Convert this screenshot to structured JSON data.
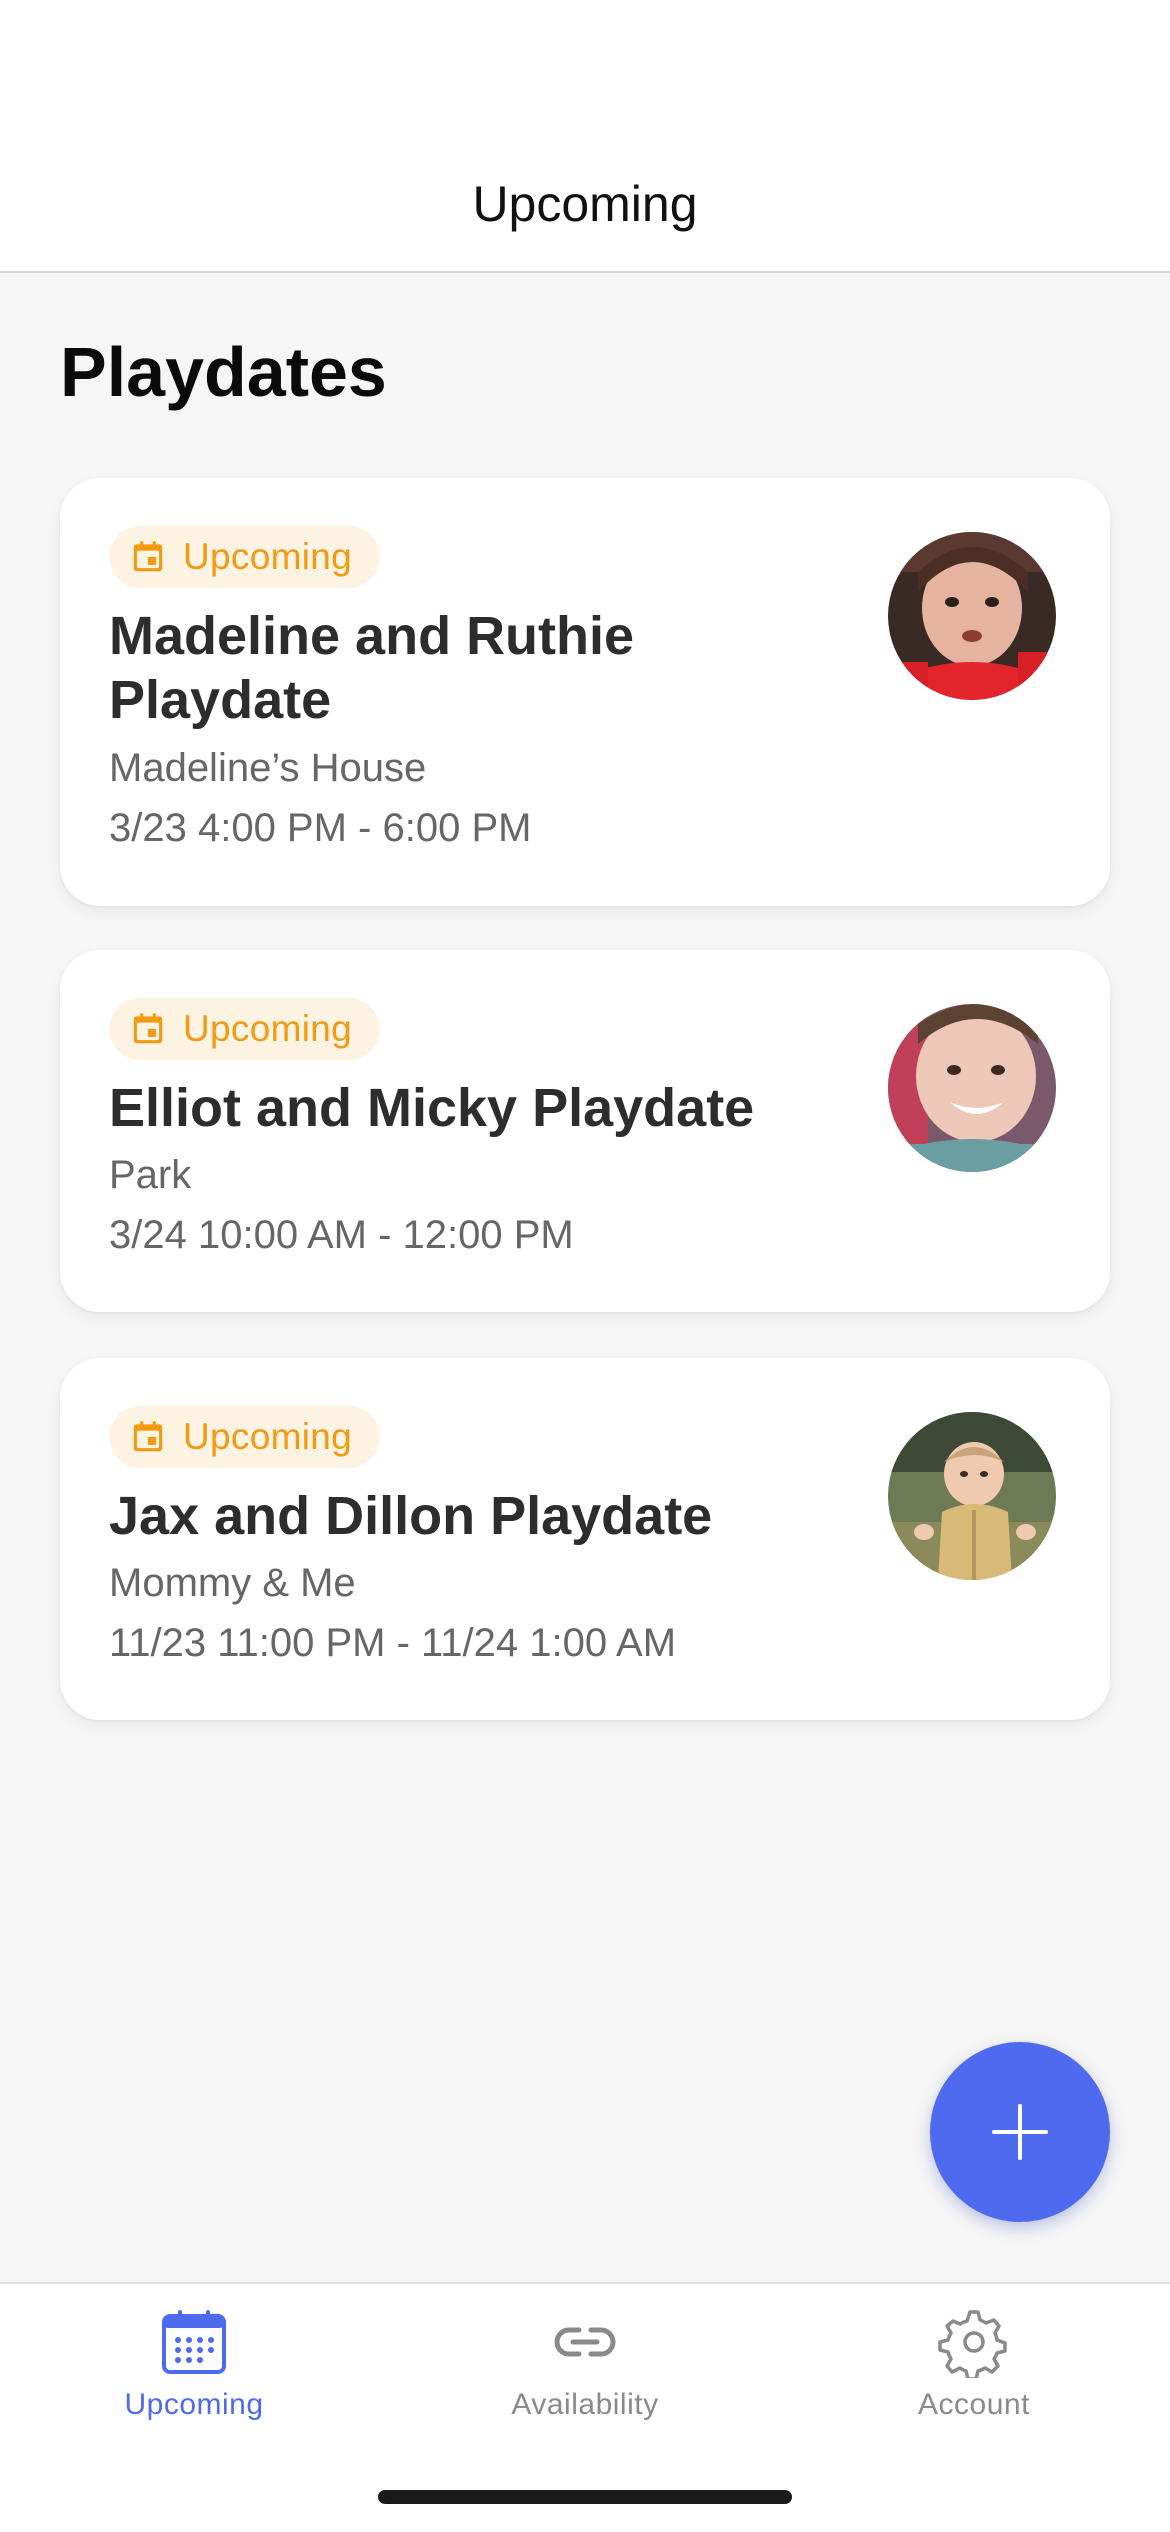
{
  "header": {
    "title": "Upcoming"
  },
  "page": {
    "title": "Playdates"
  },
  "playdates": [
    {
      "status": "Upcoming",
      "title": "Madeline and Ruthie Playdate",
      "location": "Madeline’s House",
      "time": "3/23 4:00 PM - 6:00 PM"
    },
    {
      "status": "Upcoming",
      "title": "Elliot and Micky Playdate",
      "location": "Park",
      "time": "3/24 10:00 AM - 12:00 PM"
    },
    {
      "status": "Upcoming",
      "title": "Jax and Dillon Playdate",
      "location": "Mommy & Me",
      "time": "11/23 11:00 PM - 11/24 1:00 AM"
    }
  ],
  "fab": {
    "icon": "plus-icon"
  },
  "tabs": [
    {
      "label": "Upcoming",
      "icon": "calendar-icon",
      "active": true
    },
    {
      "label": "Availability",
      "icon": "link-icon",
      "active": false
    },
    {
      "label": "Account",
      "icon": "gear-icon",
      "active": false
    }
  ],
  "colors": {
    "accent": "#4e6bef",
    "status_orange": "#f29a12",
    "status_bg": "#fdf3e3",
    "background": "#f6f6f6"
  }
}
